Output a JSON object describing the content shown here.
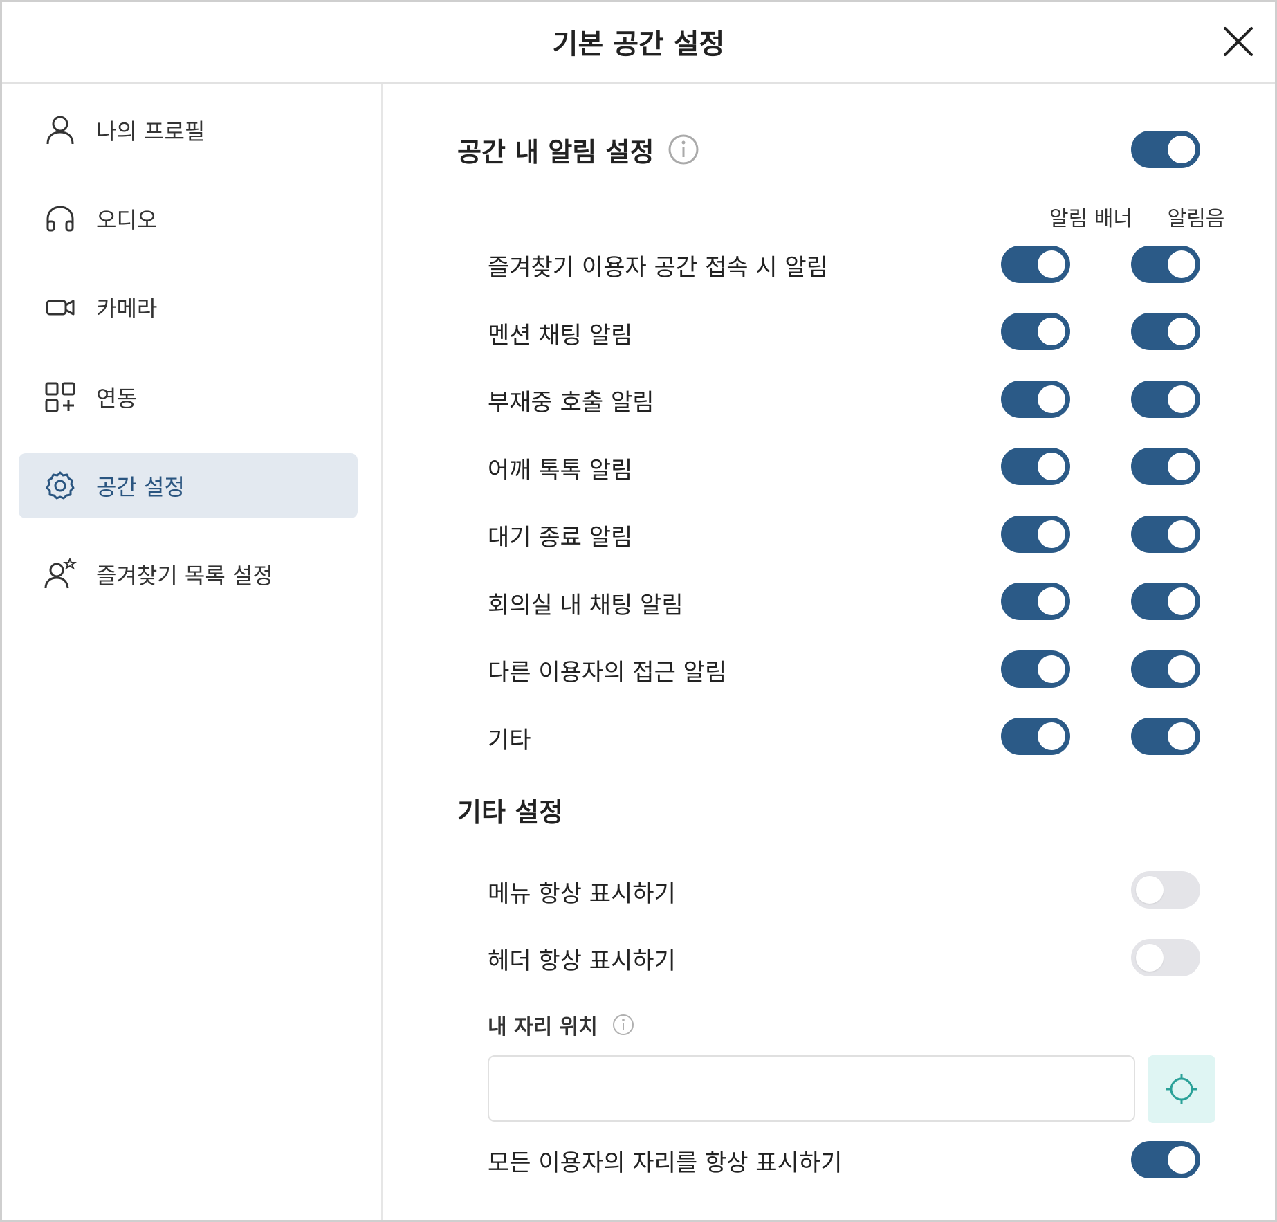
{
  "window": {
    "title": "기본 공간 설정"
  },
  "sidebar": {
    "items": [
      {
        "label": "나의 프로필",
        "icon": "user-icon"
      },
      {
        "label": "오디오",
        "icon": "headphones-icon"
      },
      {
        "label": "카메라",
        "icon": "camera-icon"
      },
      {
        "label": "연동",
        "icon": "apps-add-icon"
      },
      {
        "label": "공간 설정",
        "icon": "gear-icon",
        "active": true
      },
      {
        "label": "즐겨찾기 목록 설정",
        "icon": "user-star-icon"
      }
    ]
  },
  "notifications": {
    "title": "공간 내 알림 설정",
    "master_enabled": true,
    "columns": [
      "알림 배너",
      "알림음"
    ],
    "rows": [
      {
        "label": "즐겨찾기 이용자 공간 접속 시 알림",
        "banner": true,
        "sound": true
      },
      {
        "label": "멘션 채팅 알림",
        "banner": true,
        "sound": true
      },
      {
        "label": "부재중 호출 알림",
        "banner": true,
        "sound": true
      },
      {
        "label": "어깨 톡톡 알림",
        "banner": true,
        "sound": true
      },
      {
        "label": "대기 종료 알림",
        "banner": true,
        "sound": true
      },
      {
        "label": "회의실 내 채팅 알림",
        "banner": true,
        "sound": true
      },
      {
        "label": "다른 이용자의 접근 알림",
        "banner": true,
        "sound": true
      },
      {
        "label": "기타",
        "banner": true,
        "sound": true
      }
    ]
  },
  "other": {
    "title": "기타 설정",
    "rows": [
      {
        "label": "메뉴 항상 표시하기",
        "enabled": false
      },
      {
        "label": "헤더 항상 표시하기",
        "enabled": false
      }
    ],
    "seat_location": {
      "label": "내 자리 위치",
      "value": "",
      "placeholder": ""
    },
    "show_all_seats": {
      "label": "모든 이용자의 자리를 항상 표시하기",
      "enabled": true
    }
  },
  "colors": {
    "accent": "#2b5a87",
    "toggle_off": "#e4e4e8",
    "active_nav_bg": "#e3e9f0",
    "locate_btn_bg": "#dff5f3"
  }
}
